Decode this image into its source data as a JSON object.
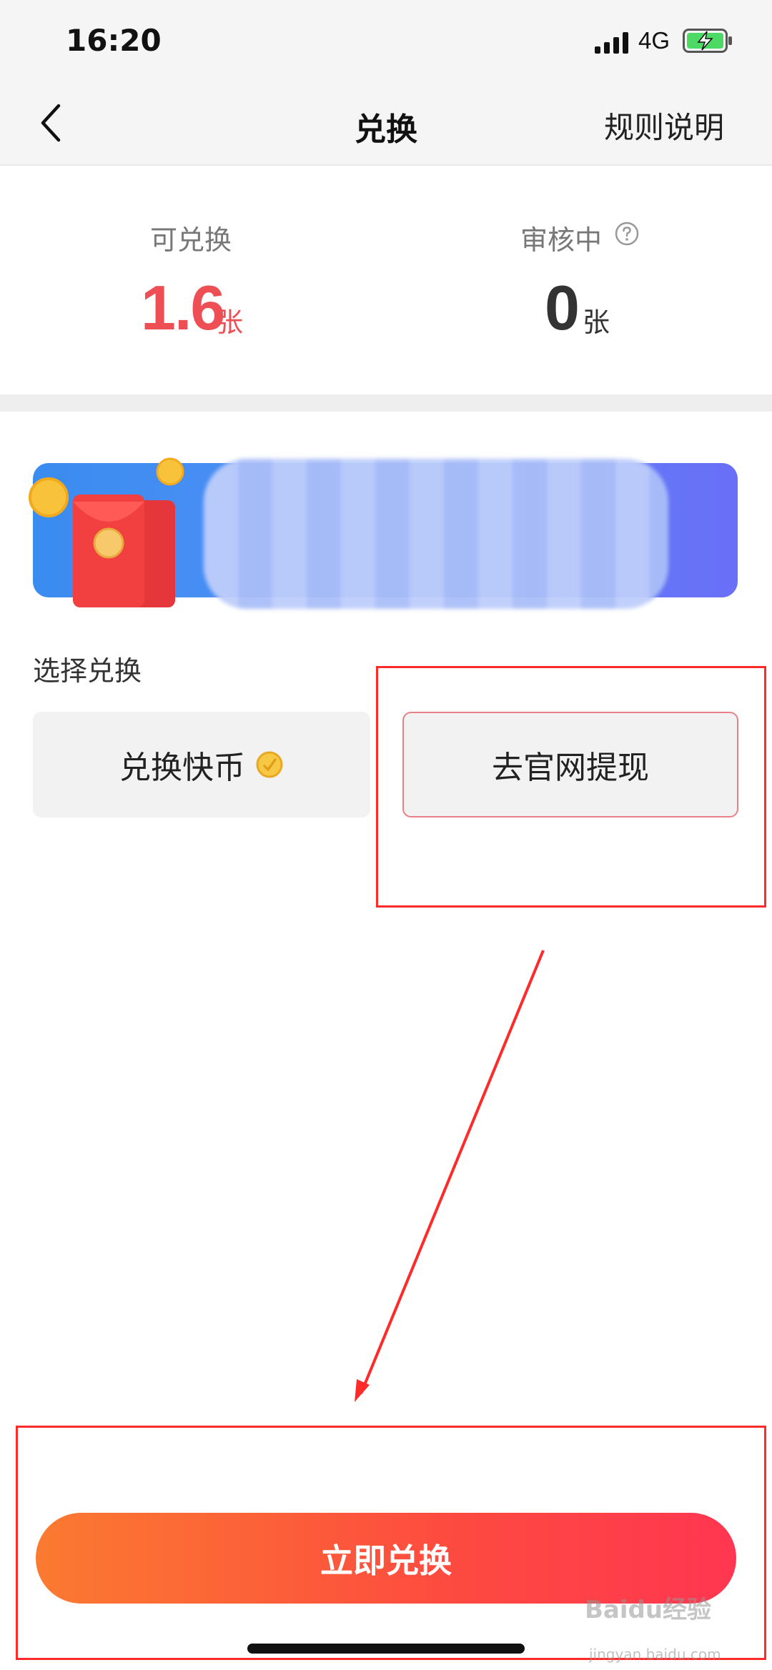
{
  "status_bar": {
    "time": "16:20",
    "network": "4G"
  },
  "nav": {
    "title": "兑换",
    "rules_label": "规则说明"
  },
  "summary": {
    "available_label": "可兑换",
    "available_value": "1.6",
    "available_unit": "张",
    "review_label": "审核中",
    "review_value": "0",
    "review_unit": "张"
  },
  "exchange": {
    "section_label": "选择兑换",
    "options": [
      {
        "label": "兑换快币",
        "icon": "coin-icon"
      },
      {
        "label": "去官网提现"
      }
    ]
  },
  "cta": {
    "label": "立即兑换"
  },
  "watermark": {
    "text": "Baidu经验",
    "sub": "jingyan.baidu.com"
  },
  "colors": {
    "accent_red": "#ee4f55",
    "cta_start": "#fb7a30",
    "cta_end": "#ff3651",
    "annotation": "#ff2a2a"
  }
}
